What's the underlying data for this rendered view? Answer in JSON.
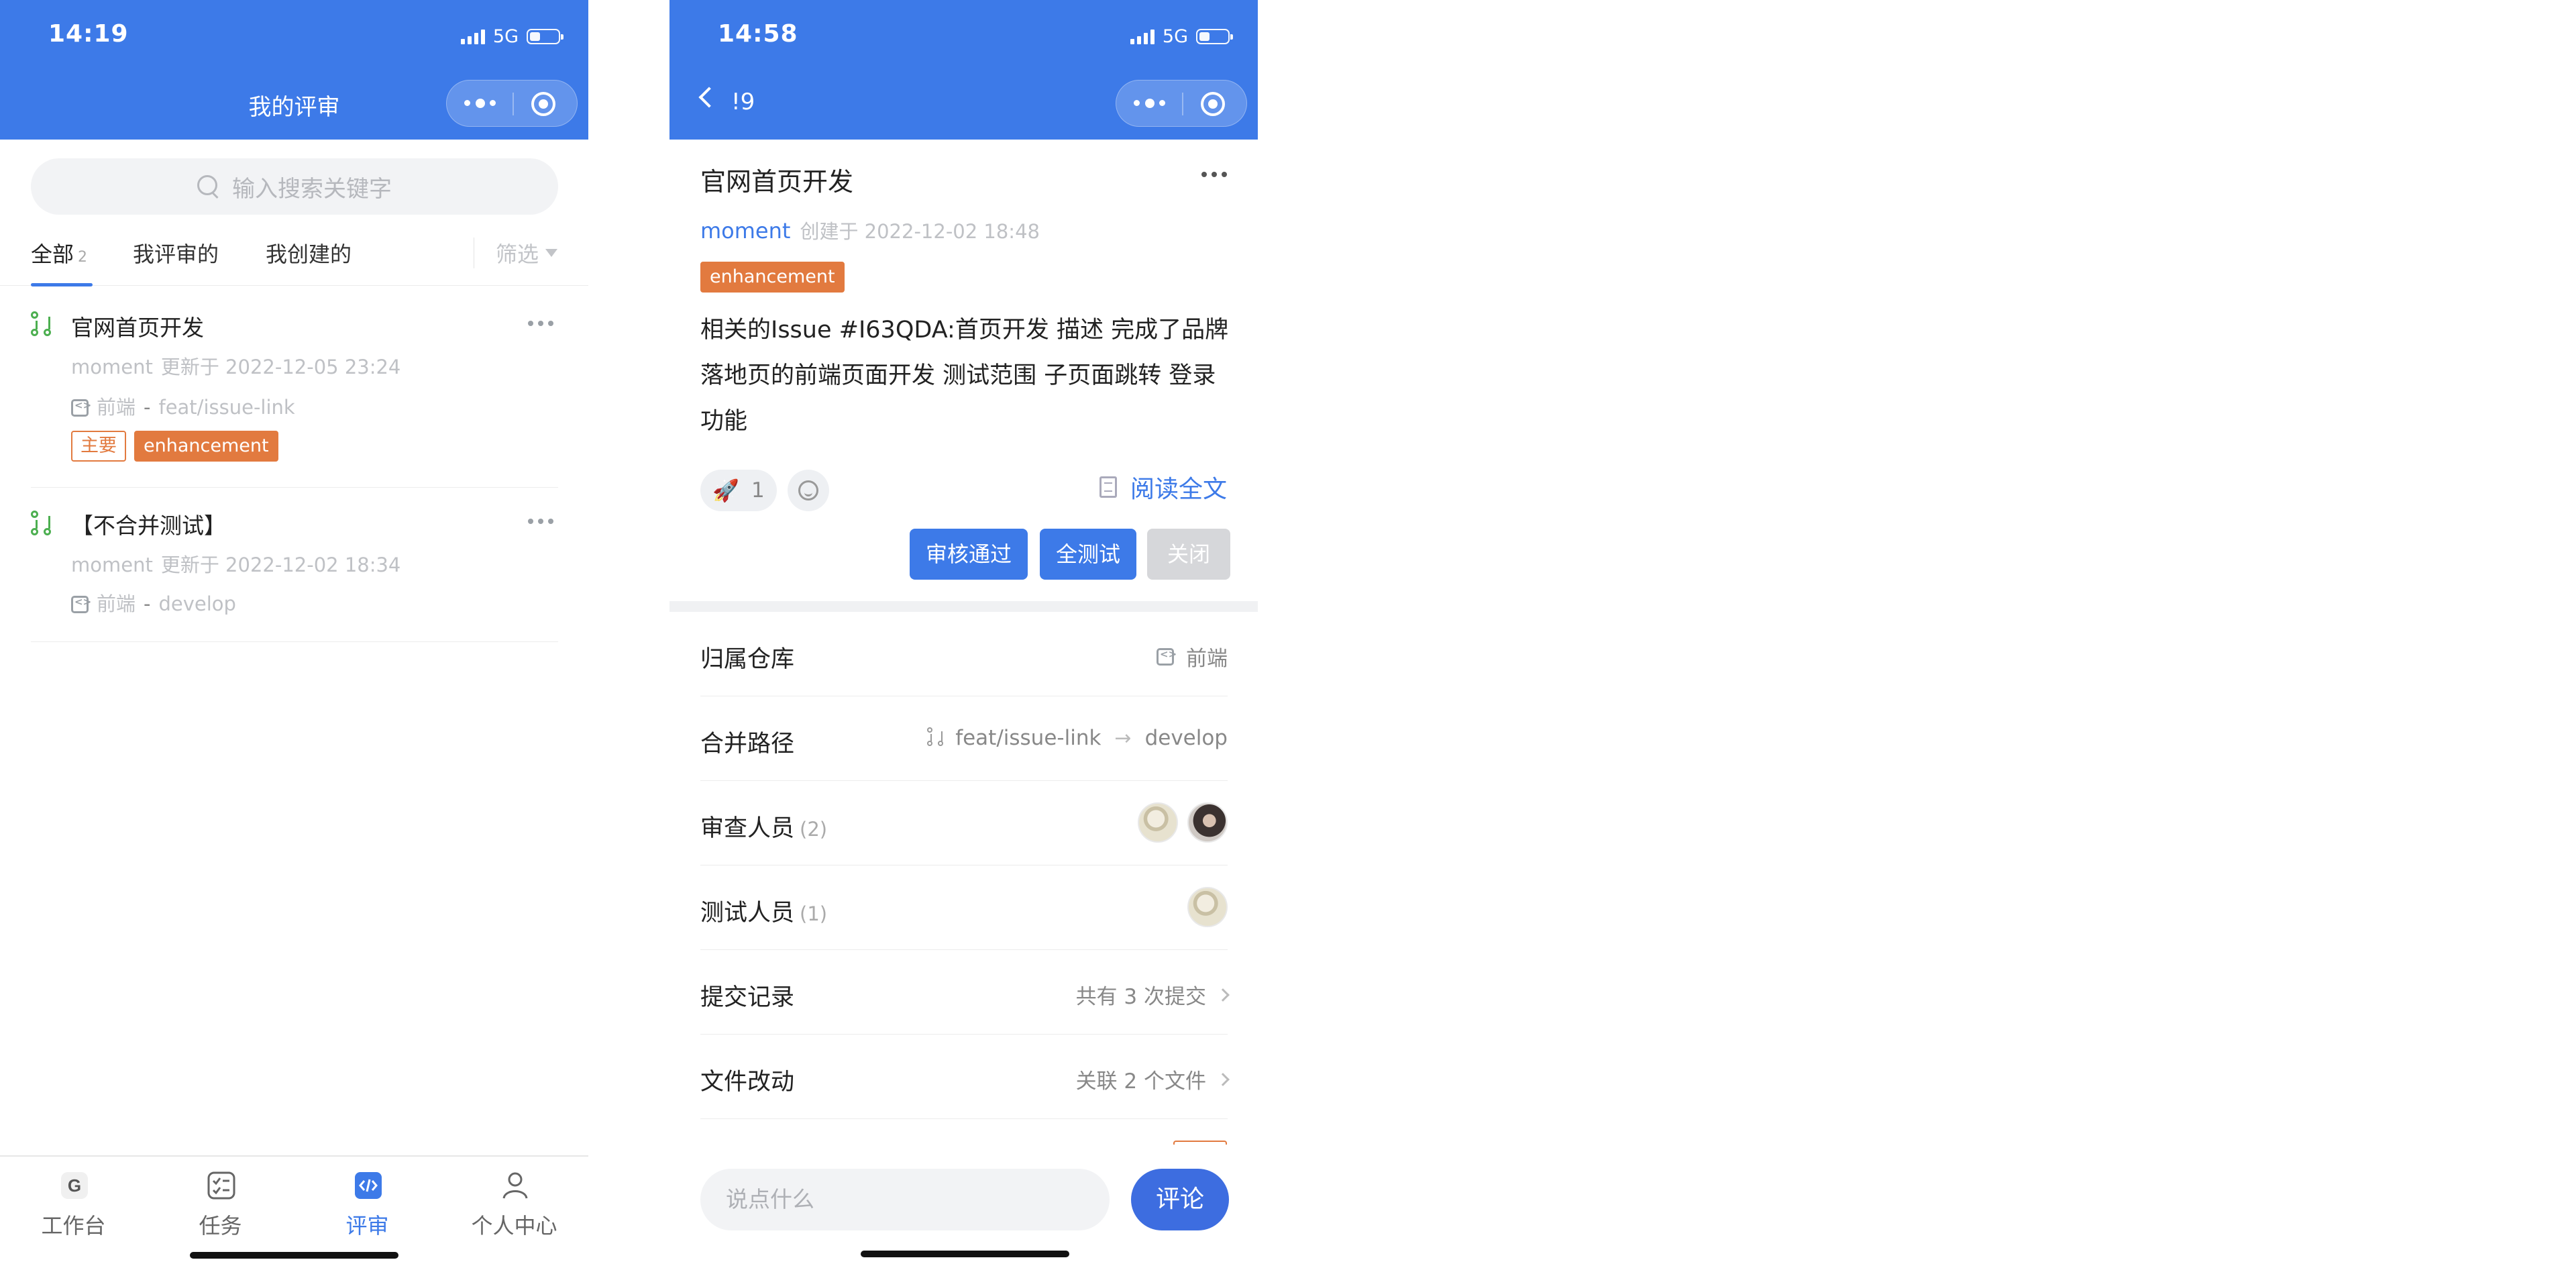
{
  "colors": {
    "primary": "#3d7ae8",
    "tag_orange": "#e27a3f",
    "muted_text": "#bfc1c5"
  },
  "left": {
    "status": {
      "time": "14:19",
      "network": "5G"
    },
    "nav_title": "我的评审",
    "search_placeholder": "输入搜索关键字",
    "tabs": [
      {
        "label": "全部",
        "count": "2"
      },
      {
        "label": "我评审的"
      },
      {
        "label": "我创建的"
      }
    ],
    "filter_label": "筛选",
    "items": [
      {
        "title": "官网首页开发",
        "author": "moment",
        "updated": "更新于 2022-12-05 23:24",
        "repo": "前端",
        "separator": "-",
        "branch": "feat/issue-link",
        "tags": [
          "主要",
          "enhancement"
        ]
      },
      {
        "title": "【不合并测试】",
        "author": "moment",
        "updated": "更新于 2022-12-02 18:34",
        "repo": "前端",
        "separator": "-",
        "branch": "develop"
      }
    ],
    "tabbar": [
      {
        "label": "工作台",
        "icon": "workbench-icon"
      },
      {
        "label": "任务",
        "icon": "task-icon"
      },
      {
        "label": "评审",
        "icon": "code-review-icon",
        "active": true
      },
      {
        "label": "个人中心",
        "icon": "profile-icon"
      }
    ]
  },
  "right": {
    "status": {
      "time": "14:58",
      "network": "5G"
    },
    "nav_title": "!9",
    "title": "官网首页开发",
    "author": "moment",
    "created": "创建于 2022-12-02 18:48",
    "tag": "enhancement",
    "description": "相关的Issue #I63QDA:首页开发 描述 完成了品牌落地页的前端页面开发 测试范围 子页面跳转 登录功能",
    "reactions": {
      "rocket_count": "1"
    },
    "read_all": "阅读全文",
    "buttons": {
      "approve": "审核通过",
      "test_all": "全测试",
      "close": "关闭"
    },
    "rows": {
      "repo": {
        "label": "归属仓库",
        "value": "前端"
      },
      "merge": {
        "label": "合并路径",
        "from": "feat/issue-link",
        "arrow": "→",
        "to": "develop"
      },
      "reviewers": {
        "label": "审查人员",
        "count": "(2)"
      },
      "testers": {
        "label": "测试人员",
        "count": "(1)"
      },
      "commits": {
        "label": "提交记录",
        "value": "共有 3 次提交"
      },
      "files": {
        "label": "文件改动",
        "value": "关联 2 个文件"
      }
    },
    "comment": {
      "placeholder": "说点什么",
      "button": "评论"
    }
  }
}
